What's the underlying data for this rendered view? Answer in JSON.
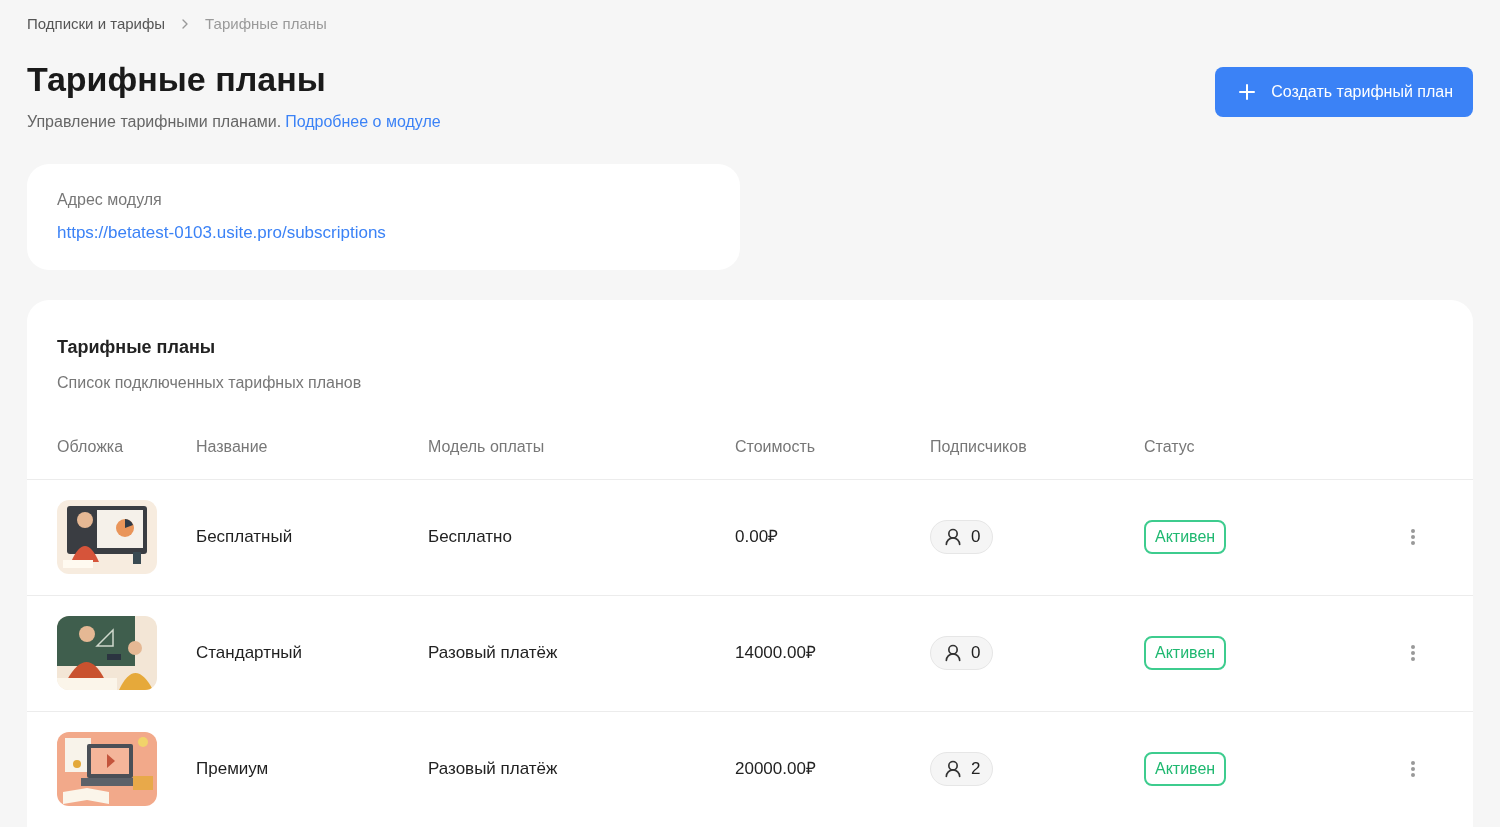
{
  "breadcrumbs": [
    {
      "label": "Подписки и тарифы",
      "current": false
    },
    {
      "label": "Тарифные планы",
      "current": true
    }
  ],
  "page": {
    "title": "Тарифные планы",
    "subtitle": "Управление тарифными планами.",
    "link": "Подробнее о модуле"
  },
  "create_button": {
    "label": "Создать тарифный план"
  },
  "module_card": {
    "label": "Адрес модуля",
    "url": "https://betatest-0103.usite.pro/subscriptions"
  },
  "plans_card": {
    "title": "Тарифные планы",
    "subtitle": "Список подключенных тарифных планов"
  },
  "table": {
    "columns": [
      "Обложка",
      "Название",
      "Модель оплаты",
      "Стоимость",
      "Подписчиков",
      "Статус"
    ],
    "rows": [
      {
        "name": "Бесплатный",
        "payment_model": "Бесплатно",
        "price": "0.00₽",
        "subscribers": "0",
        "status": {
          "label": "Активен",
          "kind": "active"
        }
      },
      {
        "name": "Стандартный",
        "payment_model": "Разовый платёж",
        "price": "14000.00₽",
        "subscribers": "0",
        "status": {
          "label": "Активен",
          "kind": "active"
        }
      },
      {
        "name": "Премиум",
        "payment_model": "Разовый платёж",
        "price": "20000.00₽",
        "subscribers": "2",
        "status": {
          "label": "Активен",
          "kind": "active"
        }
      }
    ]
  }
}
